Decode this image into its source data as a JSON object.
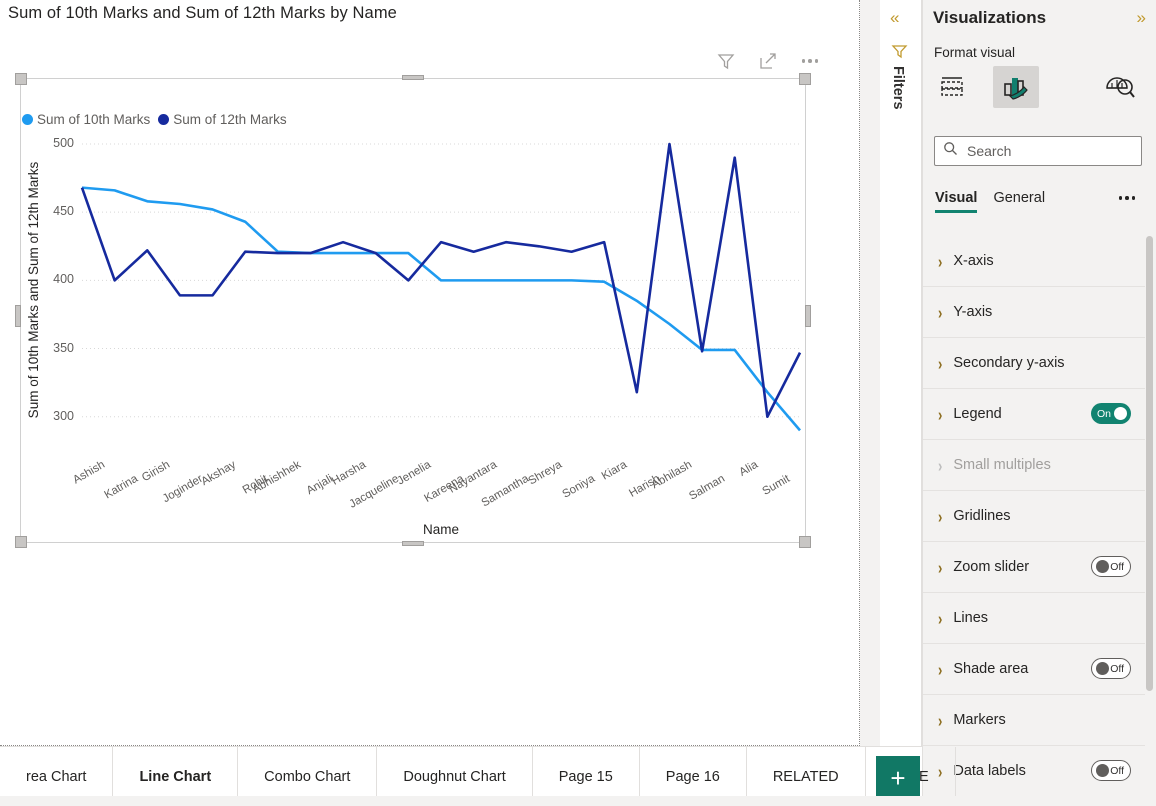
{
  "filters_pane": {
    "collapse_icon": "chevrons-left-icon",
    "funnel_icon": "filter-funnel-icon",
    "label": "Filters"
  },
  "viz_pane": {
    "title": "Visualizations",
    "expand_icon": "chevrons-right-icon",
    "format_visual_label": "Format visual",
    "icons": [
      {
        "name": "build-visual-icon",
        "selected": false
      },
      {
        "name": "format-visual-paintbrush-icon",
        "selected": true
      },
      {
        "name": "analytics-magnifier-icon",
        "selected": false
      }
    ],
    "search": {
      "placeholder": "Search",
      "value": "",
      "icon": "search-icon"
    },
    "tabs": [
      {
        "label": "Visual",
        "active": true
      },
      {
        "label": "General",
        "active": false
      }
    ],
    "more_icon": "more-options-icon",
    "format_sections": [
      {
        "label": "X-axis",
        "toggle": null,
        "disabled": false
      },
      {
        "label": "Y-axis",
        "toggle": null,
        "disabled": false
      },
      {
        "label": "Secondary y-axis",
        "toggle": null,
        "disabled": false
      },
      {
        "label": "Legend",
        "toggle": "On",
        "disabled": false
      },
      {
        "label": "Small multiples",
        "toggle": null,
        "disabled": true
      },
      {
        "label": "Gridlines",
        "toggle": null,
        "disabled": false
      },
      {
        "label": "Zoom slider",
        "toggle": "Off",
        "disabled": false
      },
      {
        "label": "Lines",
        "toggle": null,
        "disabled": false
      },
      {
        "label": "Shade area",
        "toggle": "Off",
        "disabled": false
      },
      {
        "label": "Markers",
        "toggle": null,
        "disabled": false
      },
      {
        "label": "Data labels",
        "toggle": "Off",
        "disabled": false
      }
    ]
  },
  "visual": {
    "header_icons": [
      {
        "name": "filter-icon"
      },
      {
        "name": "focus-mode-icon"
      },
      {
        "name": "more-options-icon"
      }
    ]
  },
  "page_tabs": {
    "items": [
      {
        "label": "rea Chart",
        "active": false
      },
      {
        "label": "Line Chart",
        "active": true
      },
      {
        "label": "Combo Chart",
        "active": false
      },
      {
        "label": "Doughnut Chart",
        "active": false
      },
      {
        "label": "Page 15",
        "active": false
      },
      {
        "label": "Page 16",
        "active": false
      },
      {
        "label": "RELATED",
        "active": false
      },
      {
        "label": "SELE",
        "active": false
      }
    ],
    "add_button_label": "+"
  },
  "colors": {
    "series_10th": "#1f9bf0",
    "series_12th": "#162a9e",
    "accent_teal": "#118370",
    "gold": "#c19a2e"
  },
  "chart_data": {
    "type": "line",
    "title": "Sum of 10th Marks and Sum of 12th Marks by Name",
    "xlabel": "Name",
    "ylabel": "Sum of 10th Marks and Sum of 12th Marks",
    "ylim": [
      280,
      500
    ],
    "yticks": [
      300,
      350,
      400,
      450,
      500
    ],
    "grid": true,
    "legend_position": "top-left",
    "categories": [
      "Ashish",
      "Katrina",
      "Girish",
      "Joginder",
      "Akshay",
      "Rohit",
      "Abhishhek",
      "Anjali",
      "Harsha",
      "Jacqueline",
      "Jenelia",
      "Kareena",
      "Nayantara",
      "Samantha",
      "Shreya",
      "Soniya",
      "Kiara",
      "Harish",
      "Abhilash",
      "Salman",
      "Alia",
      "Sumit"
    ],
    "series": [
      {
        "name": "Sum of 10th Marks",
        "color": "#1f9bf0",
        "values": [
          468,
          466,
          458,
          456,
          452,
          443,
          421,
          420,
          420,
          420,
          420,
          400,
          400,
          400,
          400,
          400,
          399,
          385,
          368,
          349,
          349,
          318,
          290
        ]
      },
      {
        "name": "Sum of 12th Marks",
        "color": "#162a9e",
        "values": [
          468,
          400,
          422,
          389,
          389,
          421,
          420,
          420,
          428,
          420,
          400,
          428,
          421,
          428,
          425,
          421,
          428,
          318,
          500,
          348,
          490,
          300,
          347
        ]
      }
    ]
  }
}
